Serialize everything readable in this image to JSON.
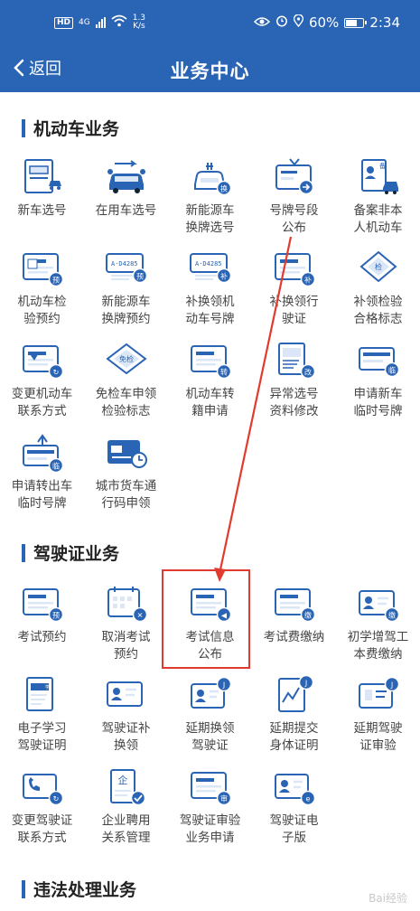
{
  "status_bar": {
    "hd": "HD",
    "network": "4G",
    "speed_value": "1.3",
    "speed_unit": "K/s",
    "battery": "60%",
    "time": "2:34"
  },
  "nav": {
    "back_label": "返回",
    "title": "业务中心"
  },
  "sections": [
    {
      "title": "机动车业务",
      "items": [
        {
          "label": "新车选号",
          "icon": "new-car-plate-icon"
        },
        {
          "label": "在用车选号",
          "icon": "used-car-plate-icon"
        },
        {
          "label": "新能源车\n换牌选号",
          "icon": "ev-plate-icon"
        },
        {
          "label": "号牌号段\n公布",
          "icon": "plate-announce-icon"
        },
        {
          "label": "备案非本\n人机动车",
          "icon": "registered-vehicle-icon"
        },
        {
          "label": "机动车检\n验预约",
          "icon": "inspection-appointment-icon"
        },
        {
          "label": "新能源车\n换牌预约",
          "icon": "ev-plate-appointment-icon"
        },
        {
          "label": "补换领机\n动车号牌",
          "icon": "replace-plate-icon"
        },
        {
          "label": "补换领行\n驶证",
          "icon": "replace-license-icon"
        },
        {
          "label": "补领检验\n合格标志",
          "icon": "inspection-mark-icon"
        },
        {
          "label": "变更机动车\n联系方式",
          "icon": "change-contact-icon"
        },
        {
          "label": "免检车申领\n检验标志",
          "icon": "exempt-mark-icon"
        },
        {
          "label": "机动车转\n籍申请",
          "icon": "transfer-icon"
        },
        {
          "label": "异常选号\n资料修改",
          "icon": "edit-data-icon"
        },
        {
          "label": "申请新车\n临时号牌",
          "icon": "temp-plate-icon"
        },
        {
          "label": "申请转出车\n临时号牌",
          "icon": "transfer-out-plate-icon"
        },
        {
          "label": "城市货车通\n行码申领",
          "icon": "truck-pass-icon"
        }
      ]
    },
    {
      "title": "驾驶证业务",
      "items": [
        {
          "label": "考试预约",
          "icon": "exam-appointment-icon"
        },
        {
          "label": "取消考试\n预约",
          "icon": "cancel-exam-icon"
        },
        {
          "label": "考试信息\n公布",
          "icon": "exam-info-icon"
        },
        {
          "label": "考试费缴纳",
          "icon": "exam-fee-icon"
        },
        {
          "label": "初学增驾工\n本费缴纳",
          "icon": "learner-fee-icon"
        },
        {
          "label": "电子学习\n驾驶证明",
          "icon": "e-learning-permit-icon"
        },
        {
          "label": "驾驶证补\n换领",
          "icon": "replace-driver-license-icon"
        },
        {
          "label": "延期换领\n驾驶证",
          "icon": "extend-renewal-icon"
        },
        {
          "label": "延期提交\n身体证明",
          "icon": "extend-health-icon"
        },
        {
          "label": "延期驾驶\n证审验",
          "icon": "extend-review-icon"
        },
        {
          "label": "变更驾驶证\n联系方式",
          "icon": "change-driver-contact-icon"
        },
        {
          "label": "企业聘用\n关系管理",
          "icon": "employment-icon"
        },
        {
          "label": "驾驶证审验\n业务申请",
          "icon": "review-apply-icon"
        },
        {
          "label": "驾驶证电\n子版",
          "icon": "e-driver-license-icon"
        }
      ]
    },
    {
      "title": "违法处理业务",
      "items": []
    }
  ],
  "watermark": "Bai经验",
  "colors": {
    "brand_blue": "#2a64b4",
    "highlight_red": "#e03b2e"
  }
}
